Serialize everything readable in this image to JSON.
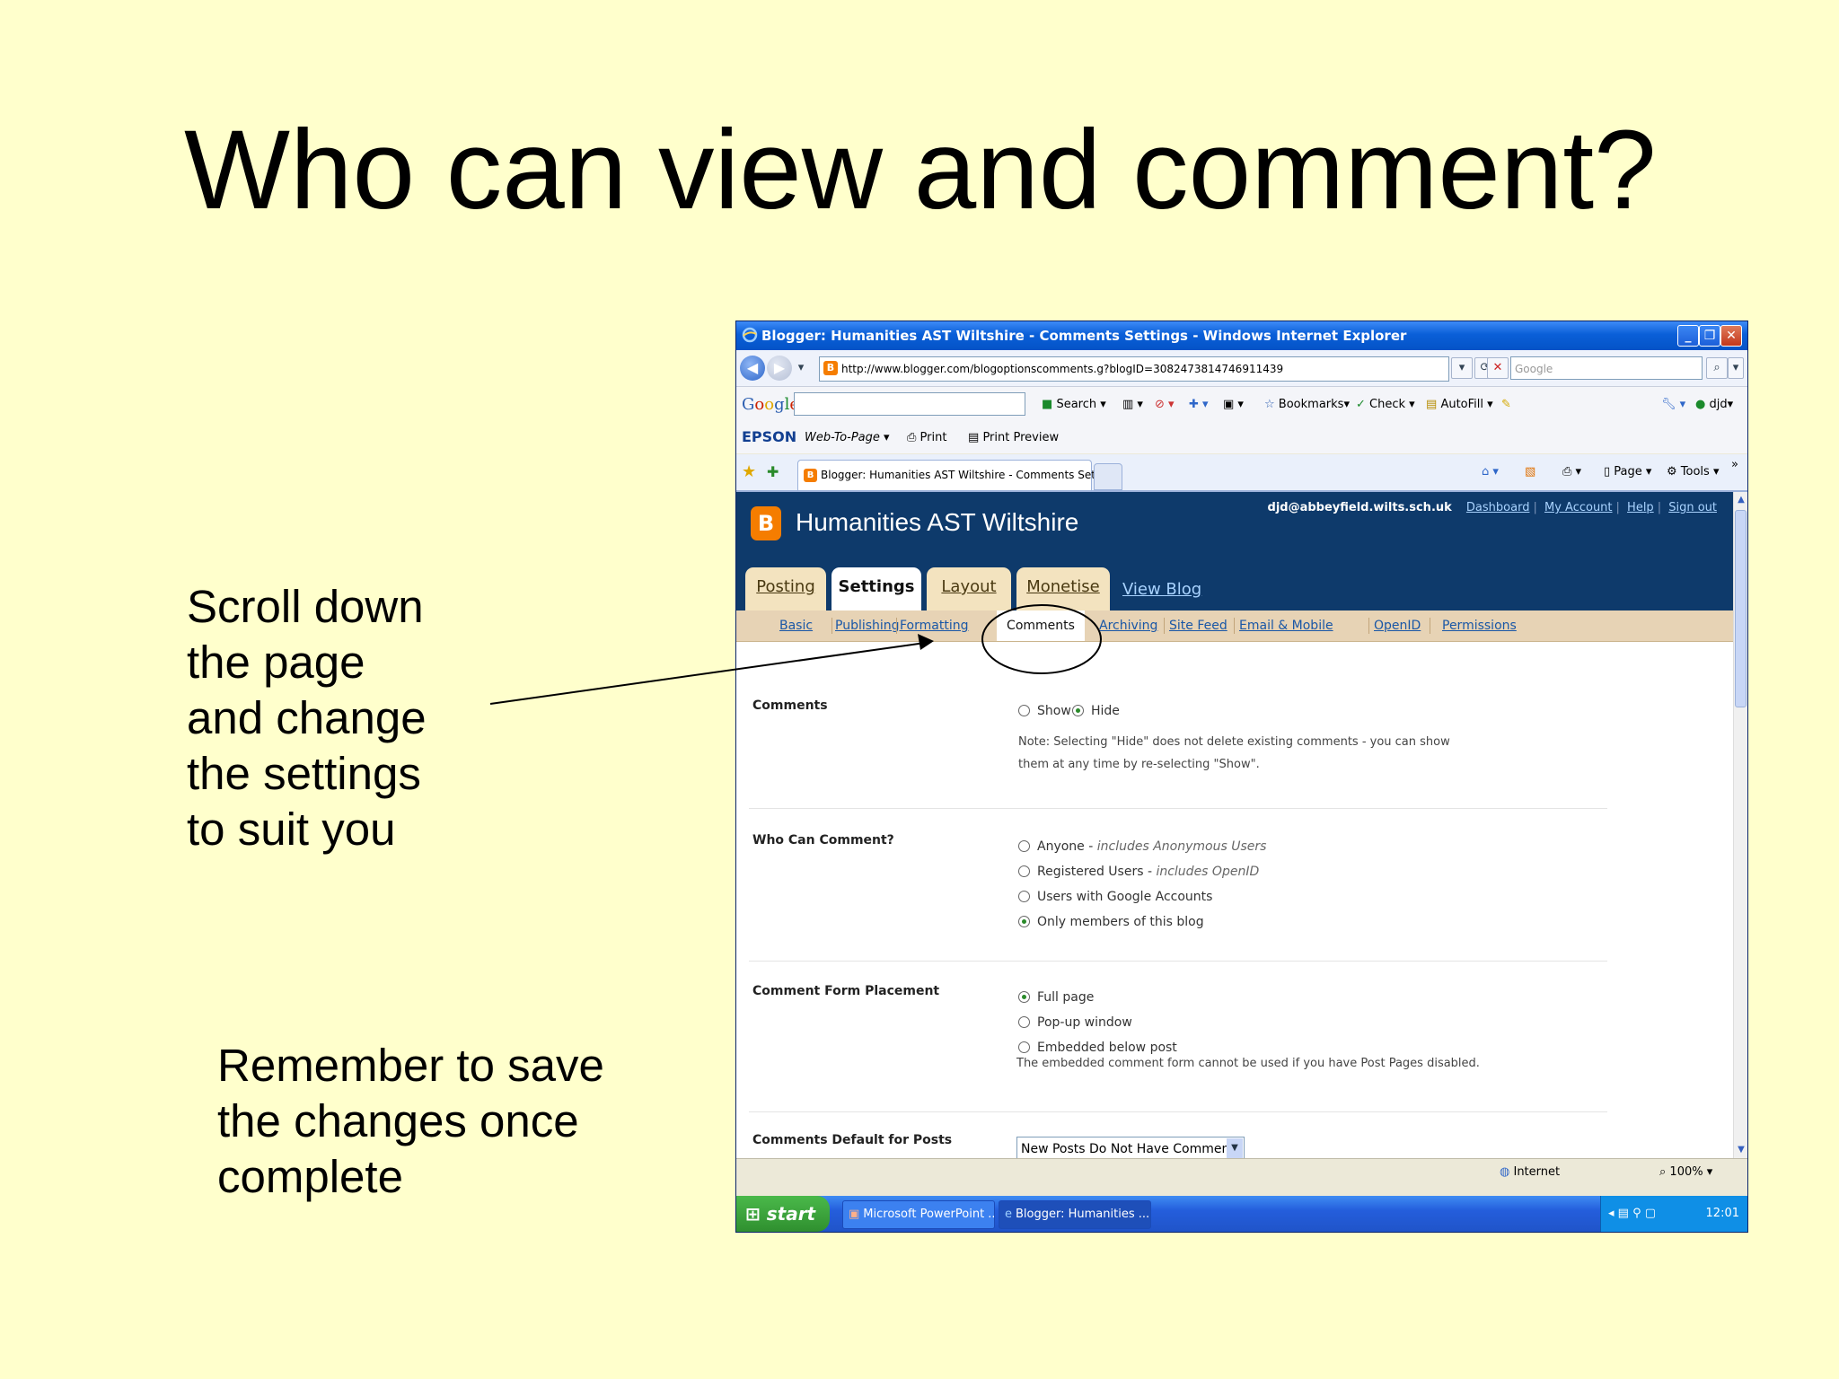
{
  "slide": {
    "title": "Who can view and comment?",
    "note1_lines": [
      "Scroll down",
      "the page",
      "and change",
      "the settings",
      "to suit you"
    ],
    "note2_lines": [
      "Remember to save",
      "the changes once",
      "complete"
    ]
  },
  "window": {
    "title": "Blogger: Humanities AST Wiltshire - Comments Settings - Windows Internet Explorer",
    "url": "http://www.blogger.com/blogoptionscomments.g?blogID=3082473814746911439",
    "search_placeholder": "Google"
  },
  "toolbar_google": {
    "search_label": "Search",
    "bookmarks_label": "Bookmarks",
    "check_label": "Check",
    "autofill_label": "AutoFill",
    "account_label": "djd"
  },
  "toolbar_epson": {
    "brand": "EPSON",
    "web_to_page": "Web-To-Page",
    "print_label": "Print",
    "print_preview_label": "Print Preview"
  },
  "tab": {
    "label": "Blogger: Humanities AST Wiltshire - Comments Settings",
    "page_label": "Page",
    "tools_label": "Tools"
  },
  "blog": {
    "name": "Humanities AST Wiltshire",
    "user_email": "djd@abbeyfield.wilts.sch.uk",
    "links": [
      "Dashboard",
      "My Account",
      "Help",
      "Sign out"
    ],
    "main_tabs": [
      "Posting",
      "Settings",
      "Layout",
      "Monetise"
    ],
    "view_blog": "View Blog",
    "sub_tabs": [
      "Basic",
      "Publishing",
      "Formatting",
      "Comments",
      "Archiving",
      "Site Feed",
      "Email & Mobile",
      "OpenID",
      "Permissions"
    ]
  },
  "settings": {
    "comments": {
      "label": "Comments",
      "options": [
        "Show",
        "Hide"
      ],
      "selected": "Hide",
      "note_lines": [
        "Note: Selecting \"Hide\" does not delete existing comments - you can show",
        "them at any time by re-selecting \"Show\"."
      ]
    },
    "who_can_comment": {
      "label": "Who Can Comment?",
      "options": [
        {
          "text": "Anyone",
          "hint": "includes Anonymous Users"
        },
        {
          "text": "Registered Users",
          "hint": "includes OpenID"
        },
        {
          "text": "Users with Google Accounts",
          "hint": ""
        },
        {
          "text": "Only members of this blog",
          "hint": ""
        }
      ],
      "selected_index": 3,
      "hint_separator": " - "
    },
    "form_placement": {
      "label": "Comment Form Placement",
      "options": [
        "Full page",
        "Pop-up window",
        "Embedded below post"
      ],
      "selected_index": 0,
      "note": "The embedded comment form cannot be used if you have Post Pages disabled."
    },
    "default_for_posts": {
      "label": "Comments Default for Posts",
      "value": "New Posts Do Not Have Comments"
    }
  },
  "statusbar": {
    "zone": "Internet",
    "zoom": "100%"
  },
  "taskbar": {
    "start": "start",
    "items": [
      "Microsoft PowerPoint ...",
      "Blogger: Humanities ..."
    ],
    "clock": "12:01"
  },
  "colors": {
    "slide_background": "#ffffcc",
    "blogger_orange": "#f57d00",
    "header_navy": "#0e3a6b",
    "tab_tan": "#f3e3bf"
  }
}
